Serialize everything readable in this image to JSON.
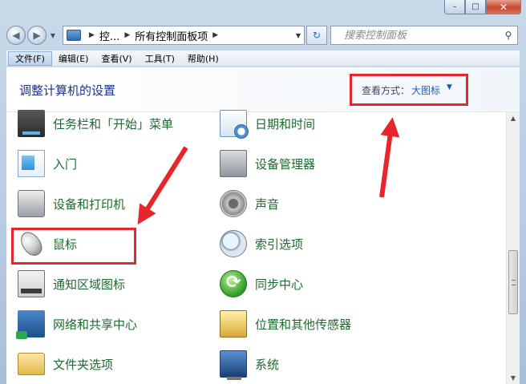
{
  "window": {
    "minimize": "–",
    "maximize": "□",
    "close": "✕"
  },
  "nav": {
    "back": "◀",
    "forward": "▶",
    "breadcrumb": [
      "控...",
      "所有控制面板项"
    ],
    "refresh": "↻",
    "search_placeholder": "搜索控制面板",
    "search_icon": "search-icon"
  },
  "menu": [
    "文件(F)",
    "编辑(E)",
    "查看(V)",
    "工具(T)",
    "帮助(H)"
  ],
  "header": {
    "title": "调整计算机的设置",
    "view_label": "查看方式：",
    "view_value": "大图标"
  },
  "items": [
    {
      "label": "任务栏和「开始」菜单",
      "icon": "taskbar-icon"
    },
    {
      "label": "日期和时间",
      "icon": "clock-icon"
    },
    {
      "label": "入门",
      "icon": "getting-started-icon"
    },
    {
      "label": "设备管理器",
      "icon": "device-manager-icon"
    },
    {
      "label": "设备和打印机",
      "icon": "printer-icon"
    },
    {
      "label": "声音",
      "icon": "speaker-icon"
    },
    {
      "label": "鼠标",
      "icon": "mouse-icon"
    },
    {
      "label": "索引选项",
      "icon": "magnifier-icon"
    },
    {
      "label": "通知区域图标",
      "icon": "notification-icon"
    },
    {
      "label": "同步中心",
      "icon": "sync-icon"
    },
    {
      "label": "网络和共享中心",
      "icon": "network-icon"
    },
    {
      "label": "位置和其他传感器",
      "icon": "location-icon"
    },
    {
      "label": "文件夹选项",
      "icon": "folder-icon"
    },
    {
      "label": "系统",
      "icon": "computer-icon"
    }
  ],
  "colors": {
    "highlight": "#e7262b",
    "item_text": "#1c6a2e",
    "title_text": "#1e3287",
    "link": "#1a5dbf"
  }
}
